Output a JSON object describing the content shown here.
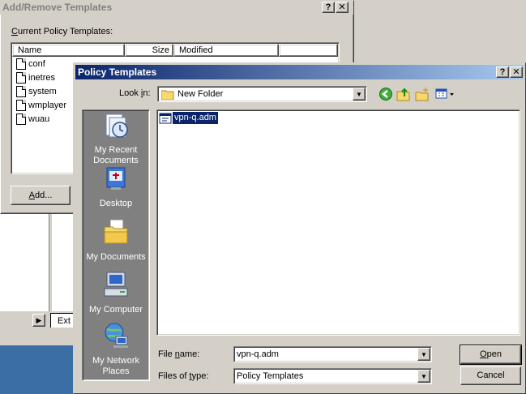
{
  "bg_window": {
    "title": "Add/Remove Templates",
    "list_label_prefix": "C",
    "list_label_rest": "urrent Policy Templates:",
    "columns": [
      "Name",
      "Size",
      "Modified"
    ],
    "items": [
      "conf",
      "inetres",
      "system",
      "wmplayer",
      "wuau"
    ],
    "add_prefix": "A",
    "add_rest": "dd...",
    "tab_label": "Ext"
  },
  "dialog": {
    "title": "Policy Templates",
    "lookin_prefix": "Look ",
    "lookin_u": "i",
    "lookin_rest": "n:",
    "lookin_value": "New Folder",
    "places": [
      {
        "icon": "recent-documents-icon",
        "line1": "My Recent",
        "line2": "Documents"
      },
      {
        "icon": "desktop-icon",
        "line1": "Desktop",
        "line2": ""
      },
      {
        "icon": "my-documents-icon",
        "line1": "My Documents",
        "line2": ""
      },
      {
        "icon": "my-computer-icon",
        "line1": "My Computer",
        "line2": ""
      },
      {
        "icon": "my-network-places-icon",
        "line1": "My Network",
        "line2": "Places"
      }
    ],
    "file": "vpn-q.adm",
    "filename_label_a": "File ",
    "filename_label_u": "n",
    "filename_label_b": "ame:",
    "filename_value": "vpn-q.adm",
    "filetype_label_a": "Files of ",
    "filetype_label_u": "t",
    "filetype_label_b": "ype:",
    "filetype_value": "Policy Templates",
    "open_u": "O",
    "open_rest": "pen",
    "cancel_label": "Cancel"
  },
  "colors": {
    "title_active": "#0a246a",
    "desktop": "#3a6ea5",
    "places_bar": "#808080"
  }
}
